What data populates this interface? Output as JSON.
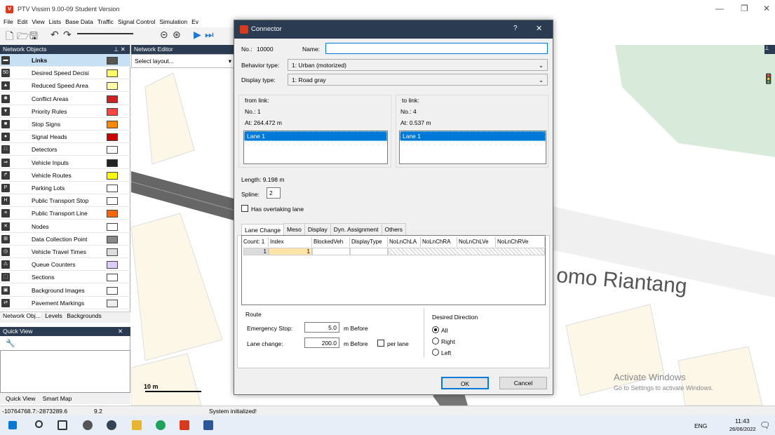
{
  "app": {
    "title": "PTV Vissim 9.00-09 Student Version",
    "logo": "V"
  },
  "menu": [
    "File",
    "Edit",
    "View",
    "Lists",
    "Base Data",
    "Traffic",
    "Signal Control",
    "Simulation",
    "Ev"
  ],
  "network_objects": {
    "title": "Network Objects",
    "items": [
      {
        "label": "Links",
        "icon": "links-icon",
        "swatch": "#555555",
        "selected": true
      },
      {
        "label": "Desired Speed Decisi",
        "icon": "speed-50-icon",
        "swatch": "#ffff66"
      },
      {
        "label": "Reduced Speed Area",
        "icon": "warning-triangle-icon",
        "swatch": "#ffffaa"
      },
      {
        "label": "Conflict Areas",
        "icon": "conflict-icon",
        "swatch": "#cc2222"
      },
      {
        "label": "Priority Rules",
        "icon": "yield-icon",
        "swatch": "#ff4444"
      },
      {
        "label": "Stop Signs",
        "icon": "stop-icon",
        "swatch": "#ff8800"
      },
      {
        "label": "Signal Heads",
        "icon": "signal-icon",
        "swatch": "#cc0000"
      },
      {
        "label": "Detectors",
        "icon": "detector-icon",
        "swatch": "#ffffff"
      },
      {
        "label": "Vehicle Inputs",
        "icon": "vehicle-input-icon",
        "swatch": "#222222"
      },
      {
        "label": "Vehicle Routes",
        "icon": "route-icon",
        "swatch": "#ffff00"
      },
      {
        "label": "Parking Lots",
        "icon": "parking-icon",
        "swatch": "#ffffff"
      },
      {
        "label": "Public Transport Stop",
        "icon": "pt-stop-icon",
        "swatch": "#ffffff"
      },
      {
        "label": "Public Transport Line",
        "icon": "pt-line-icon",
        "swatch": "#ff6600"
      },
      {
        "label": "Nodes",
        "icon": "nodes-icon",
        "swatch": "#ffffff"
      },
      {
        "label": "Data Collection Point",
        "icon": "dcp-icon",
        "swatch": "#888888"
      },
      {
        "label": "Vehicle Travel Times",
        "icon": "travel-time-icon",
        "swatch": "#dddddd"
      },
      {
        "label": "Queue Counters",
        "icon": "queue-icon",
        "swatch": "#ddccff"
      },
      {
        "label": "Sections",
        "icon": "sections-icon",
        "swatch": "#ffffff"
      },
      {
        "label": "Background Images",
        "icon": "background-icon",
        "swatch": "#ffffff"
      },
      {
        "label": "Pavement Markings",
        "icon": "pavement-icon",
        "swatch": "#eeeeee"
      }
    ],
    "tabs": [
      "Network Obj...",
      "Levels",
      "Backgrounds"
    ]
  },
  "quick_view": {
    "title": "Quick View",
    "tabs": [
      "Quick View",
      "Smart Map"
    ]
  },
  "network_editor": {
    "title": "Network Editor",
    "layout_placeholder": "Select layout...",
    "scale": "10 m",
    "street_label": "omo Riantang"
  },
  "status": {
    "coords": "-10764768.7:-2873289.6",
    "zoom": "9.2",
    "message": "System initialized!"
  },
  "dialog": {
    "title": "Connector",
    "no_label": "No.:",
    "no_value": "10000",
    "name_label": "Name:",
    "name_value": "",
    "behavior_label": "Behavior type:",
    "behavior_value": "1: Urban (motorized)",
    "display_label": "Display type:",
    "display_value": "1: Road gray",
    "from": {
      "title": "from link:",
      "no": "No.:  1",
      "at": "At:   264.472  m",
      "lane": "Lane 1"
    },
    "to": {
      "title": "to link:",
      "no": "No.: 4",
      "at": "At:   0.537  m",
      "lane": "Lane 1"
    },
    "length": "Length:  9.198  m",
    "spline_label": "Spline:",
    "spline_value": "2",
    "overtaking": "Has overtaking lane",
    "tabs": [
      "Lane Change",
      "Meso",
      "Display",
      "Dyn. Assignment",
      "Others"
    ],
    "grid": {
      "headers": [
        "Count: 1",
        "Index",
        "BlockedVeh",
        "DisplayType",
        "NoLnChLA",
        "NoLnChRA",
        "NoLnChLVe",
        "NoLnChRVe"
      ],
      "row": [
        "1",
        "1"
      ]
    },
    "route_title": "Route",
    "emergency_label": "Emergency Stop:",
    "emergency_value": "5.0",
    "emergency_unit": "m  Before",
    "lanechange_label": "Lane change:",
    "lanechange_value": "200.0",
    "lanechange_unit": "m  Before",
    "per_lane": "per lane",
    "direction_title": "Desired Direction",
    "directions": [
      "All",
      "Right",
      "Left"
    ],
    "ok": "OK",
    "cancel": "Cancel"
  },
  "watermark": {
    "line1": "Activate Windows",
    "line2": "Go to Settings to activate Windows."
  },
  "tray": {
    "lang": "ENG",
    "time": "11:43",
    "date": "26/06/2022"
  }
}
